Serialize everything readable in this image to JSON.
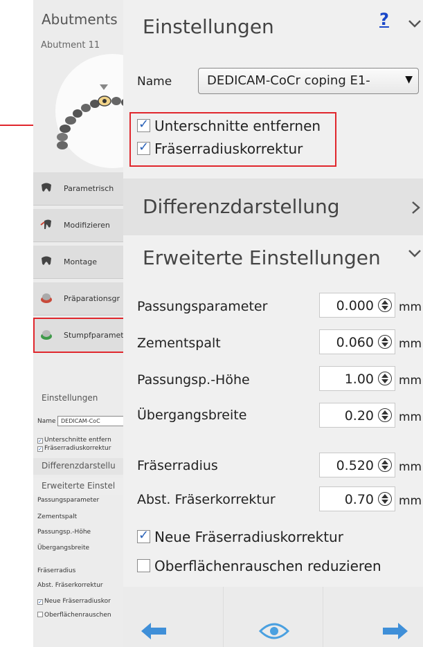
{
  "left_panel": {
    "title": "Abutments",
    "subtitle": "Abutment 11",
    "nav": [
      {
        "label": "Parametrisch",
        "icon": "tooth-icon"
      },
      {
        "label": "Modifizieren",
        "icon": "modify-tooth-icon"
      },
      {
        "label": "Montage",
        "icon": "tooth-icon"
      },
      {
        "label": "Präparationsgr",
        "icon": "preparation-icon"
      },
      {
        "label": "Stumpfparamet",
        "icon": "stump-icon"
      }
    ],
    "mini": {
      "settings_title": "Einstellungen",
      "name_label": "Name",
      "name_value": "DEDICAM-CoC",
      "check1": "Unterschnitte entfern",
      "check2": "Fräserradiuskorrektur",
      "diff_title": "Differenzdarstellu",
      "adv_title": "Erweiterte Einstel",
      "params": [
        "Passungsparameter",
        "Zementspalt",
        "Passungsp.-Höhe",
        "Übergangsbreite",
        "Fräserradius",
        "Abst. Fräserkorrektur"
      ],
      "check3": "Neue Fräserradiuskor",
      "check4": "Oberflächenrauschen"
    }
  },
  "settings": {
    "title": "Einstellungen",
    "help": "?",
    "name_label": "Name",
    "name_value": "DEDICAM-CoCr coping E1-",
    "undercut_label": "Unterschnitte entfernen",
    "undercut_checked": true,
    "cutter_label": "Fräserradiuskorrektur",
    "cutter_checked": true
  },
  "difference": {
    "title": "Differenzdarstellung"
  },
  "advanced": {
    "title": "Erweiterte Einstellungen",
    "params": [
      {
        "label": "Passungsparameter",
        "value": "0.000",
        "unit": "mm"
      },
      {
        "label": "Zementspalt",
        "value": "0.060",
        "unit": "mm"
      },
      {
        "label": "Passungsp.-Höhe",
        "value": "1.00",
        "unit": "mm"
      },
      {
        "label": "Übergangsbreite",
        "value": "0.20",
        "unit": "mm"
      },
      {
        "label": "Fräserradius",
        "value": "0.520",
        "unit": "mm"
      },
      {
        "label": "Abst. Fräserkorrektur",
        "value": "0.70",
        "unit": "mm"
      }
    ],
    "new_cutter_label": "Neue Fräserradiuskorrektur",
    "new_cutter_checked": true,
    "noise_label": "Oberflächenrauschen reduzieren",
    "noise_checked": false
  },
  "colors": {
    "highlight": "#e0262c",
    "nav_arrow": "#3f8fd8",
    "eye": "#4aa0e0",
    "checkmark": "#2a62b8",
    "help": "#1a47c8"
  }
}
